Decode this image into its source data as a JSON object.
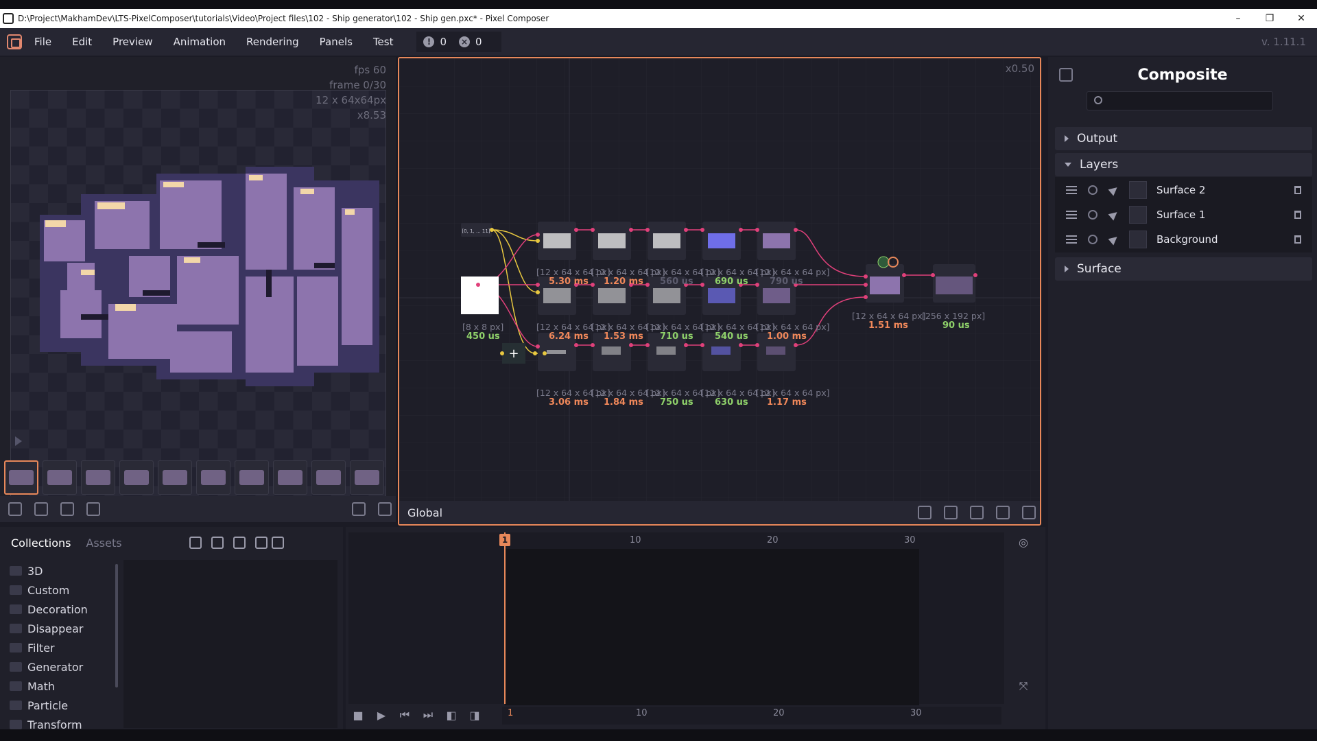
{
  "window": {
    "title": "D:\\Project\\MakhamDev\\LTS-PixelComposer\\tutorials\\Video\\Project files\\102 - Ship generator\\102 - Ship gen.pxc* - Pixel Composer",
    "minimize": "–",
    "maximize": "❐",
    "close": "✕"
  },
  "menu": {
    "items": [
      "File",
      "Edit",
      "Preview",
      "Animation",
      "Rendering",
      "Panels",
      "Test"
    ],
    "warnings": "0",
    "errors": "0",
    "version": "v. 1.11.1"
  },
  "preview": {
    "fps": "fps 60",
    "frame": "frame 0/30",
    "size": "12 x 64x64px",
    "zoom": "x8.53"
  },
  "graph": {
    "zoom": "x0.50",
    "context": "Global",
    "input_node_label": "[0, 1, ... 11]",
    "nodes": {
      "row1": [
        {
          "size": "[12 x 64 x 64 px]",
          "time": "5.30 ms"
        },
        {
          "size": "[12 x 64 x 64 px]",
          "time": "1.20 ms"
        },
        {
          "size": "[12 x 64 x 64 px]",
          "time": "560 us"
        },
        {
          "size": "[12 x 64 x 64 px]",
          "time": "690 us"
        },
        {
          "size": "[12 x 64 x 64 px]",
          "time": "790 us"
        }
      ],
      "row2": [
        {
          "size": "[12 x 64 x 64 px]",
          "time": "6.24 ms"
        },
        {
          "size": "[12 x 64 x 64 px]",
          "time": "1.53 ms"
        },
        {
          "size": "[12 x 64 x 64 px]",
          "time": "710 us"
        },
        {
          "size": "[12 x 64 x 64 px]",
          "time": "540 us"
        },
        {
          "size": "[12 x 64 x 64 px]",
          "time": "1.00 ms"
        }
      ],
      "row3": [
        {
          "size": "[12 x 64 x 64 px]",
          "time": "3.06 ms"
        },
        {
          "size": "[12 x 64 x 64 px]",
          "time": "1.84 ms"
        },
        {
          "size": "[12 x 64 x 64 px]",
          "time": "750 us"
        },
        {
          "size": "[12 x 64 x 64 px]",
          "time": "630 us"
        },
        {
          "size": "[12 x 64 x 64 px]",
          "time": "1.17 ms"
        }
      ],
      "white": {
        "size": "[8 x 8 px]",
        "time": "450 us"
      },
      "composite": {
        "size": "[12 x 64 x 64 px]",
        "time": "1.51 ms"
      },
      "output": {
        "size": "[256 x 192 px]",
        "time": "90 us"
      }
    }
  },
  "inspector": {
    "title": "Composite",
    "sections": {
      "output": "Output",
      "layers": "Layers",
      "surface": "Surface"
    },
    "layers": [
      "Surface 2",
      "Surface 1",
      "Background"
    ]
  },
  "collections": {
    "tabs": [
      "Collections",
      "Assets"
    ],
    "folders": [
      "3D",
      "Custom",
      "Decoration",
      "Disappear",
      "Filter",
      "Generator",
      "Math",
      "Particle",
      "Transform"
    ]
  },
  "timeline": {
    "current": "1",
    "ruler": [
      "10",
      "20",
      "30"
    ],
    "scrub": [
      "1",
      "10",
      "20",
      "30"
    ]
  },
  "colors": {
    "accent": "#e8885a",
    "wire_pink": "#e0407a",
    "wire_yellow": "#e8c840",
    "ok_green": "#8fd16a"
  }
}
